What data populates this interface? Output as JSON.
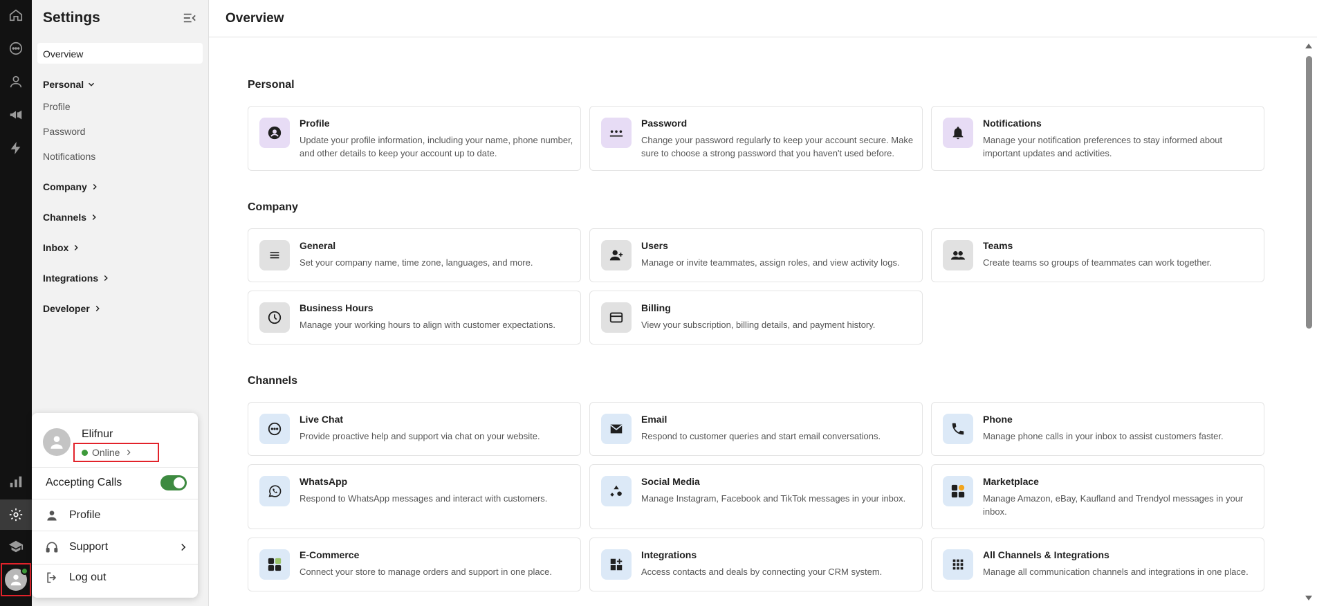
{
  "sidebar": {
    "title": "Settings",
    "overview": "Overview",
    "groups": [
      {
        "label": "Personal",
        "items": [
          "Profile",
          "Password",
          "Notifications"
        ]
      },
      {
        "label": "Company"
      },
      {
        "label": "Channels"
      },
      {
        "label": "Inbox"
      },
      {
        "label": "Integrations"
      },
      {
        "label": "Developer"
      }
    ]
  },
  "popup": {
    "user_name": "Elifnur",
    "status": "Online",
    "accepting_calls": "Accepting Calls",
    "accepting_calls_on": true,
    "profile": "Profile",
    "support": "Support",
    "logout": "Log out"
  },
  "main": {
    "page_title": "Overview",
    "sections": [
      {
        "title": "Personal",
        "cards": [
          {
            "title": "Profile",
            "desc": "Update your profile information, including your name, phone number, and other details to keep your account up to date.",
            "icon": "account-circle-icon"
          },
          {
            "title": "Password",
            "desc": "Change your password regularly to keep your account secure. Make sure to choose a strong password that you haven't used before.",
            "icon": "password-dots-icon"
          },
          {
            "title": "Notifications",
            "desc": "Manage your notification preferences to stay informed about important updates and activities.",
            "icon": "bell-icon"
          }
        ]
      },
      {
        "title": "Company",
        "cards": [
          {
            "title": "General",
            "desc": "Set your company name, time zone, languages, and more.",
            "icon": "menu-lines-icon"
          },
          {
            "title": "Users",
            "desc": "Manage or invite teammates, assign roles, and view activity logs.",
            "icon": "person-add-icon"
          },
          {
            "title": "Teams",
            "desc": "Create teams so groups of teammates can work together.",
            "icon": "group-icon"
          },
          {
            "title": "Business Hours",
            "desc": "Manage your working hours to align with customer expectations.",
            "icon": "clock-icon"
          },
          {
            "title": "Billing",
            "desc": "View your subscription, billing details, and payment history.",
            "icon": "credit-card-icon"
          }
        ]
      },
      {
        "title": "Channels",
        "cards": [
          {
            "title": "Live Chat",
            "desc": "Provide proactive help and support via chat on your website.",
            "icon": "chat-bubble-icon"
          },
          {
            "title": "Email",
            "desc": "Respond to customer queries and start email conversations.",
            "icon": "envelope-icon"
          },
          {
            "title": "Phone",
            "desc": "Manage phone calls in your inbox to assist customers faster.",
            "icon": "phone-icon"
          },
          {
            "title": "WhatsApp",
            "desc": "Respond to WhatsApp messages and interact with customers.",
            "icon": "whatsapp-icon"
          },
          {
            "title": "Social Media",
            "desc": "Manage Instagram, Facebook and TikTok messages in your inbox.",
            "icon": "shapes-icon"
          },
          {
            "title": "Marketplace",
            "desc": "Manage Amazon, eBay, Kaufland and Trendyol messages in your inbox.",
            "icon": "marketplace-grid-icon"
          },
          {
            "title": "E-Commerce",
            "desc": "Connect your store to manage orders and support in one place.",
            "icon": "ecommerce-grid-icon"
          },
          {
            "title": "Integrations",
            "desc": "Access contacts and deals by connecting your CRM system.",
            "icon": "widgets-add-icon"
          },
          {
            "title": "All Channels & Integrations",
            "desc": "Manage all communication channels and integrations in one place.",
            "icon": "apps-grid-icon"
          }
        ]
      }
    ]
  },
  "colors": {
    "rail_bg": "#121212",
    "sidebar_bg": "#f2f2f2",
    "online_green": "#3d9a3a",
    "highlight_red": "#e2222a",
    "icon_purple_bg": "#e7dcf5",
    "icon_grey_bg": "#e1e1e1",
    "icon_blue_bg": "#dce9f7"
  }
}
